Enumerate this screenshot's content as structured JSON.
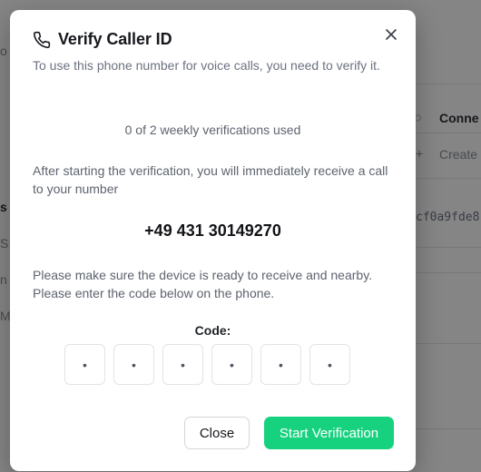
{
  "background": {
    "header_connect": "Conne",
    "create_label": "Create",
    "hash_fragment": "cf0a9fde8",
    "left_fragments": [
      "o",
      "s",
      "S",
      "n",
      "Me"
    ]
  },
  "modal": {
    "title": "Verify Caller ID",
    "subtitle": "To use this phone number for voice calls, you need to verify it.",
    "usage": "0 of 2 weekly verifications used",
    "info": "After starting the verification, you will immediately receive a call to your number",
    "phone_number": "+49 431 30149270",
    "instructions": "Please make sure the device is ready to receive and nearby. Please enter the code below on the phone.",
    "code_label": "Code:",
    "code_digits": [
      "•",
      "•",
      "•",
      "•",
      "•",
      "•"
    ],
    "close_button": "Close",
    "start_button": "Start Verification"
  },
  "colors": {
    "accent": "#16d27e",
    "overlay": "rgba(0,0,0,0.48)"
  },
  "icons": {
    "title_icon": "phone-icon",
    "close_icon": "close-icon"
  }
}
